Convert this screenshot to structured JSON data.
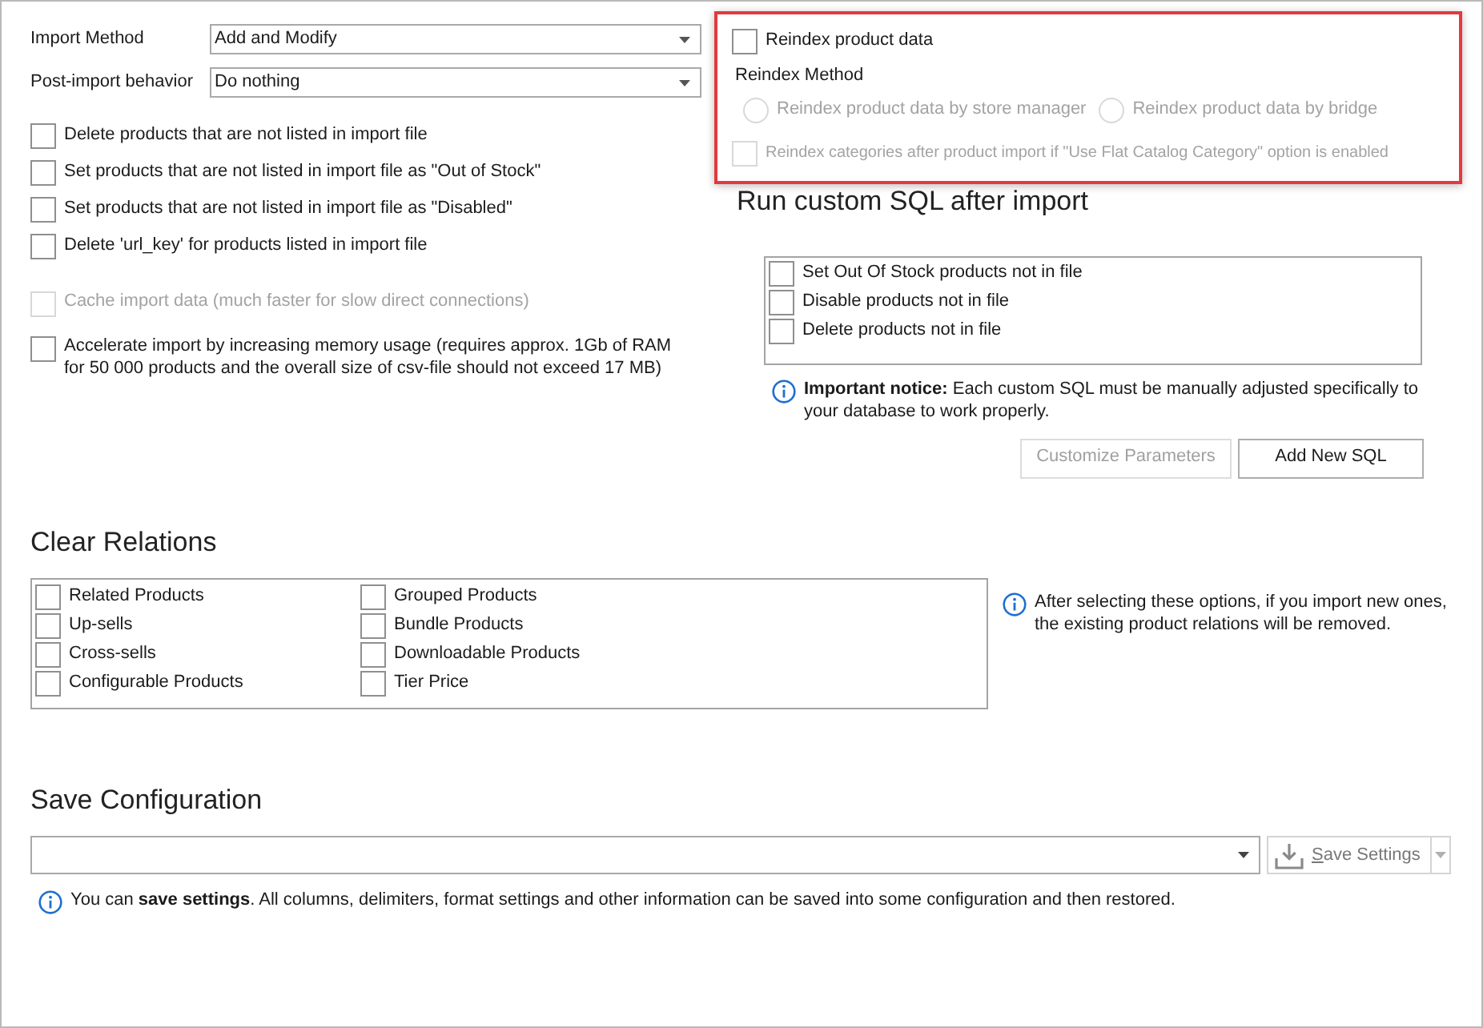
{
  "import_settings": {
    "fields": [
      {
        "label": "Import Method",
        "value": "Add and Modify"
      },
      {
        "label": "Post-import behavior",
        "value": "Do nothing"
      }
    ],
    "options": [
      {
        "label": "Delete products that are not listed in import file",
        "checked": false
      },
      {
        "label": "Set products that are not listed in import file as \"Out of Stock\"",
        "checked": false
      },
      {
        "label": "Set products that are not listed in import file as \"Disabled\"",
        "checked": false
      },
      {
        "label": "Delete 'url_key' for products listed in import file",
        "checked": false
      }
    ],
    "extra_options": [
      {
        "label": "Cache import data (much faster for slow direct connections)",
        "checked": false,
        "disabled": true
      },
      {
        "label": "Accelerate import by increasing memory usage (requires approx. 1Gb of RAM for 50 000 products and the overall size of csv-file should not exceed 17 MB)",
        "checked": false,
        "disabled": false
      }
    ]
  },
  "reindex": {
    "highlighted": true,
    "checkbox": {
      "label": "Reindex product data",
      "checked": false
    },
    "method_label": "Reindex Method",
    "methods": [
      {
        "label": "Reindex product data by store manager",
        "selected": false,
        "disabled": true
      },
      {
        "label": "Reindex product data by bridge",
        "selected": false,
        "disabled": true
      }
    ],
    "categories_option": {
      "label": "Reindex categories after product import if \"Use Flat Catalog Category\" option is enabled",
      "checked": false,
      "disabled": true
    }
  },
  "custom_sql": {
    "title": "Run custom SQL after import",
    "items": [
      {
        "label": "Set Out Of Stock products not in file",
        "checked": false
      },
      {
        "label": "Disable products not in file",
        "checked": false
      },
      {
        "label": "Delete products not in file",
        "checked": false
      }
    ],
    "notice": "**Important notice:** Each custom SQL must be manually adjusted specifically to your database to work properly.",
    "buttons": [
      {
        "label": "Customize Parameters",
        "disabled": true
      },
      {
        "label": "Add New SQL",
        "disabled": false
      }
    ]
  },
  "clear_relations": {
    "title": "Clear Relations",
    "items": [
      {
        "label": "Related Products",
        "checked": false
      },
      {
        "label": "Up-sells",
        "checked": false
      },
      {
        "label": "Cross-sells",
        "checked": false
      },
      {
        "label": "Configurable Products",
        "checked": false
      },
      {
        "label": "Grouped Products",
        "checked": false
      },
      {
        "label": "Bundle Products",
        "checked": false
      },
      {
        "label": "Downloadable Products",
        "checked": false
      },
      {
        "label": "Tier Price",
        "checked": false
      }
    ],
    "notice": "After selecting these options, if you import new ones, the existing product relations will be removed."
  },
  "save_configuration": {
    "title": "Save Configuration",
    "button": {
      "label": "Save Settings",
      "disabled": true
    },
    "notice": "You can **save settings**. All columns, delimiters, format settings and other information can be saved into some configuration and then restored."
  }
}
